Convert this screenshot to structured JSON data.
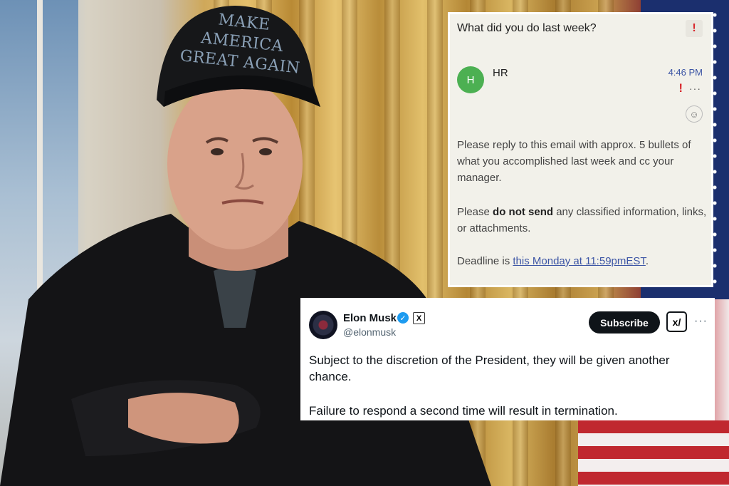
{
  "email": {
    "subject": "What did you do last week?",
    "sender_initial": "H",
    "sender": "HR",
    "time": "4:46 PM",
    "more": "···",
    "body_1": "Please reply to this email with approx. 5 bullets of what you accomplished last week and cc your manager.",
    "body_2_pre": "Please ",
    "body_2_bold": "do not send",
    "body_2_post": " any classified information, links, or attachments.",
    "body_3_pre": "Deadline is ",
    "body_3_link": "this Monday at 11:59pmEST",
    "body_3_post": ".",
    "alert_color": "#d8262b"
  },
  "tweet": {
    "name": "Elon Musk",
    "handle": "@elonmusk",
    "subscribe_label": "Subscribe",
    "grok_label": "x/",
    "more": "···",
    "text_1": "Subject to the discretion of the President, they will be given another chance.",
    "text_2": "Failure to respond a second time will result in termination.",
    "verified_color": "#1d9bf0"
  },
  "photo": {
    "cap_text": "MAKE AMERICA GREAT AGAIN"
  }
}
